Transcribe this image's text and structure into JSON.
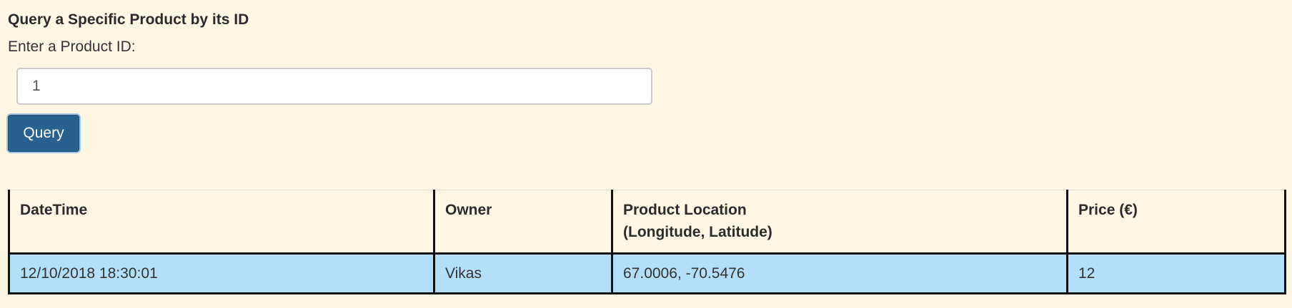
{
  "section": {
    "title": "Query a Specific Product by its ID",
    "input_label": "Enter a Product ID:"
  },
  "search": {
    "value": "1",
    "button_label": "Query"
  },
  "table": {
    "headers": [
      {
        "line1": "DateTime",
        "line2": ""
      },
      {
        "line1": "Owner",
        "line2": ""
      },
      {
        "line1": "Product Location",
        "line2": "(Longitude, Latitude)"
      },
      {
        "line1": "Price (€)",
        "line2": ""
      }
    ],
    "rows": [
      [
        "12/10/2018 18:30:01",
        "Vikas",
        "67.0006, -70.5476",
        "12"
      ]
    ]
  },
  "colors": {
    "background": "#fdf7e4",
    "button": "#286090",
    "row_highlight": "#b3dff9"
  }
}
